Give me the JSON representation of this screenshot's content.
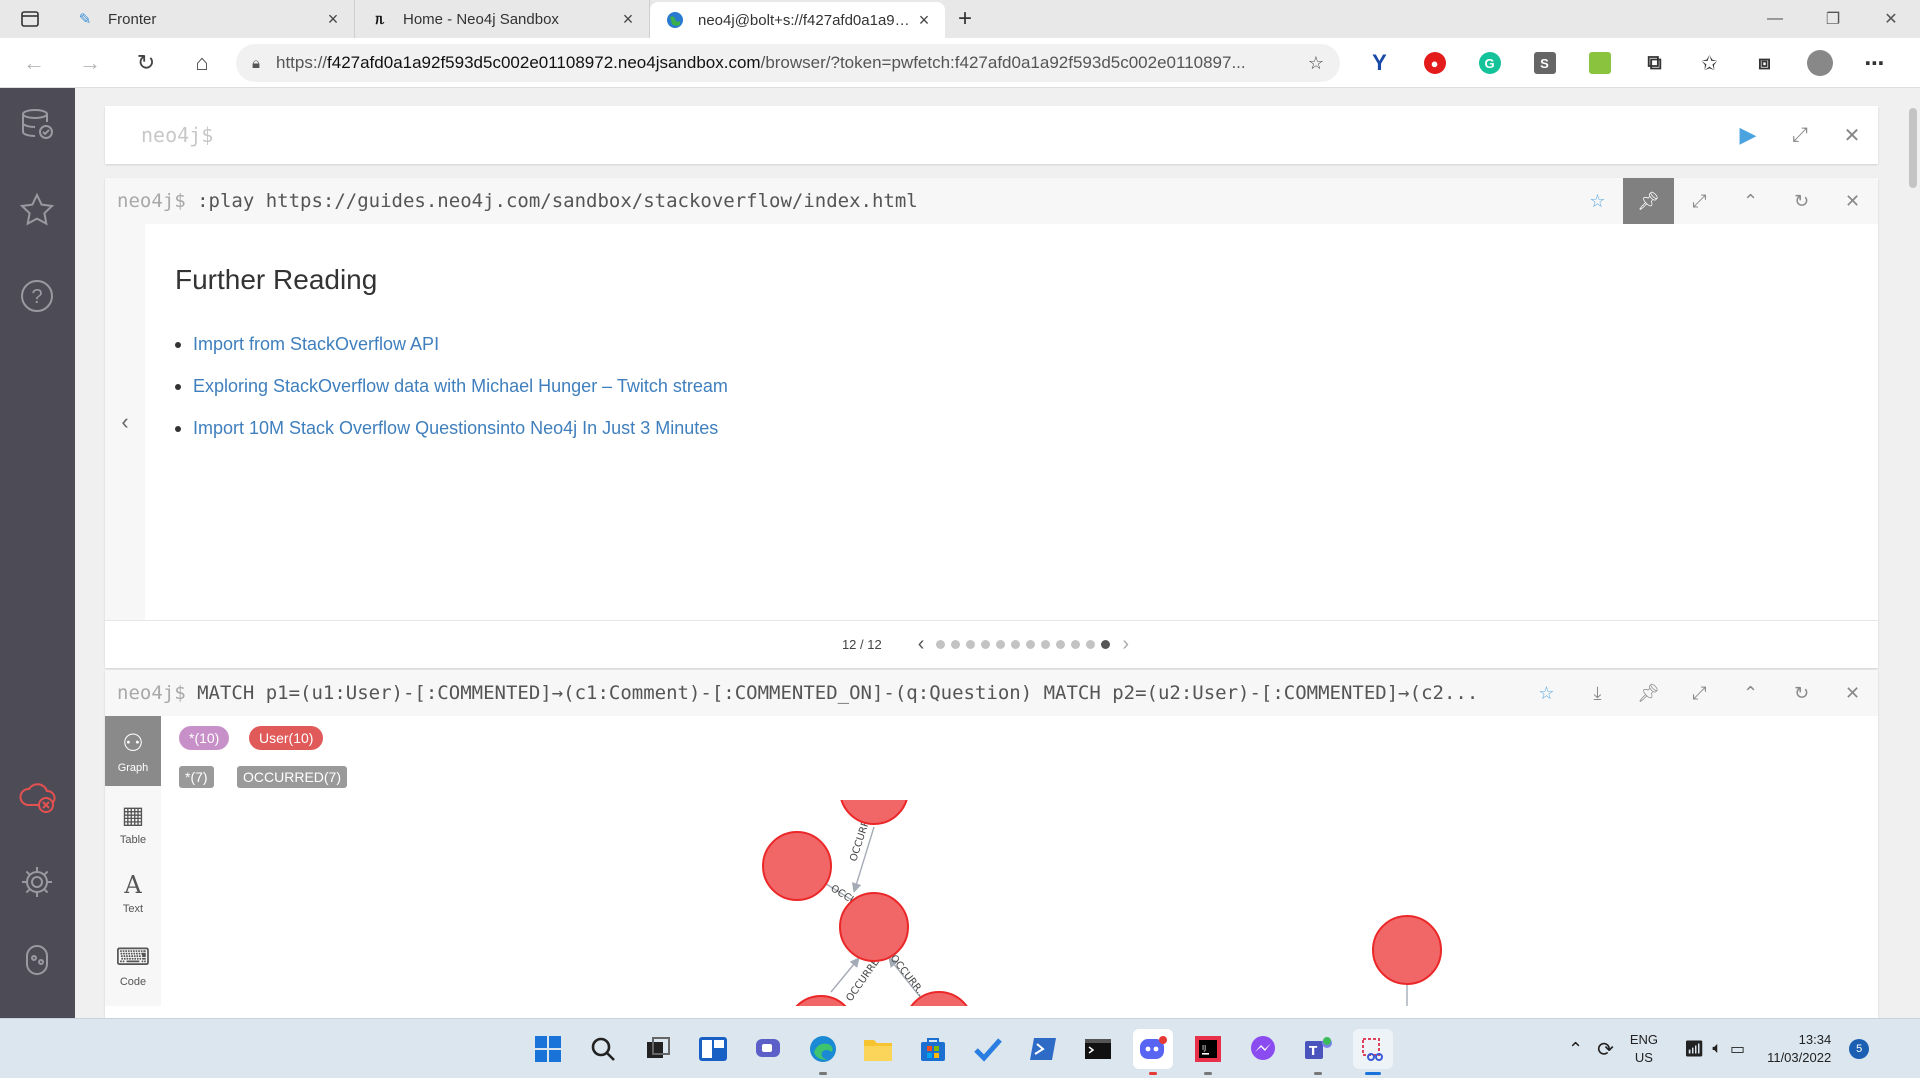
{
  "browser": {
    "tabs": [
      {
        "title": "Fronter",
        "active": false
      },
      {
        "title": "Home - Neo4j Sandbox",
        "active": false
      },
      {
        "title": "neo4j@bolt+s://f427afd0a1a92f5",
        "active": true
      }
    ],
    "url_prefix": "https://",
    "url_host": "f427afd0a1a92f593d5c002e01108972.neo4jsandbox.com",
    "url_rest": "/browser/?token=pwfetch:f427afd0a1a92f593d5c002e0110897...",
    "new_tab": "+"
  },
  "editor": {
    "placeholder": "neo4j$"
  },
  "guide_frame": {
    "prompt": "neo4j$",
    "command": ":play https://guides.neo4j.com/sandbox/stackoverflow/index.html",
    "heading": "Further Reading",
    "links": [
      "Import from StackOverflow API",
      "Exploring StackOverflow data with Michael Hunger – Twitch stream",
      "Import 10M Stack Overflow Questionsinto Neo4j In Just 3 Minutes"
    ],
    "pager": "12 / 12",
    "slide_count": 12,
    "current_slide": 12
  },
  "query_frame": {
    "prompt": "neo4j$",
    "command": "MATCH p1=(u1:User)-[:COMMENTED]→(c1:Comment)-[:COMMENTED_ON]-(q:Question) MATCH p2=(u2:User)-[:COMMENTED]→(c2...",
    "view_tabs": [
      {
        "label": "Graph",
        "active": true
      },
      {
        "label": "Table",
        "active": false
      },
      {
        "label": "Text",
        "active": false
      },
      {
        "label": "Code",
        "active": false
      }
    ],
    "node_labels": [
      {
        "text": "*(10)",
        "color": "#c890c8"
      },
      {
        "text": "User(10)",
        "color": "#e05a5a"
      }
    ],
    "rel_types": [
      {
        "text": "*(7)",
        "color": "#9a9a9a"
      },
      {
        "text": "OCCURRED(7)",
        "color": "#9a9a9a"
      }
    ],
    "rel_captions": [
      "OCCURRED",
      "OCCURR...",
      "OCCURRED",
      "OCCURR..."
    ]
  },
  "taskbar": {
    "language": "ENG",
    "region": "US",
    "time": "13:34",
    "date": "11/03/2022",
    "notifications": "5"
  },
  "colors": {
    "node": "#f16667",
    "node_stroke": "#eb2728",
    "link": "#3f7fbd",
    "sidebar": "#4d4b55"
  }
}
